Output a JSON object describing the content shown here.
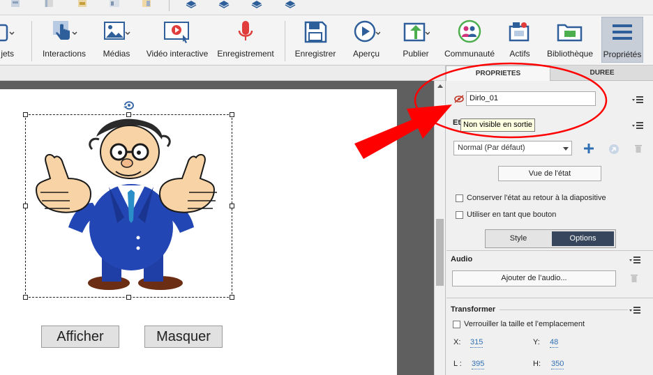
{
  "ribbon": {
    "partial_label": "jets",
    "items": [
      {
        "label": "Interactions",
        "icon": "interactions-hand-icon"
      },
      {
        "label": "Médias",
        "icon": "media-image-icon"
      },
      {
        "label": "Vidéo interactive",
        "icon": "interactive-video-icon"
      },
      {
        "label": "Enregistrement",
        "icon": "microphone-icon"
      },
      {
        "label": "Enregistrer",
        "icon": "save-disk-icon"
      },
      {
        "label": "Aperçu",
        "icon": "preview-play-icon"
      },
      {
        "label": "Publier",
        "icon": "publish-icon"
      },
      {
        "label": "Communauté",
        "icon": "community-icon"
      },
      {
        "label": "Actifs",
        "icon": "assets-icon"
      },
      {
        "label": "Bibliothèque",
        "icon": "library-book-icon"
      },
      {
        "label": "Propriétés",
        "icon": "properties-list-icon"
      }
    ]
  },
  "slide": {
    "buttons": {
      "show": "Afficher",
      "hide": "Masquer"
    }
  },
  "panel": {
    "tabs": {
      "properties": "PROPRIETES",
      "duration": "DUREE"
    },
    "object_name": "Dirlo_01",
    "tooltip": "Non visible en sortie",
    "state_label": "Et",
    "state_select": "Normal (Par défaut)",
    "state_view_button": "Vue de l'état",
    "checkbox_keep_state": "Conserver l'état au retour à la diapositive",
    "checkbox_use_as_button": "Utiliser en tant que bouton",
    "segment": {
      "style": "Style",
      "options": "Options"
    },
    "audio": {
      "title": "Audio",
      "add_button": "Ajouter de l’audio..."
    },
    "transform": {
      "title": "Transformer",
      "lock_label": "Verrouiller la taille et l’emplacement",
      "x_label": "X:",
      "x_value": "315",
      "y_label": "Y:",
      "y_value": "48",
      "w_label": "L :",
      "w_value": "395",
      "h_label": "H:",
      "h_value": "350"
    }
  },
  "colors": {
    "annotation_red": "#ff0000",
    "active_segment": "#37465c",
    "link_value": "#2f6fb3"
  }
}
